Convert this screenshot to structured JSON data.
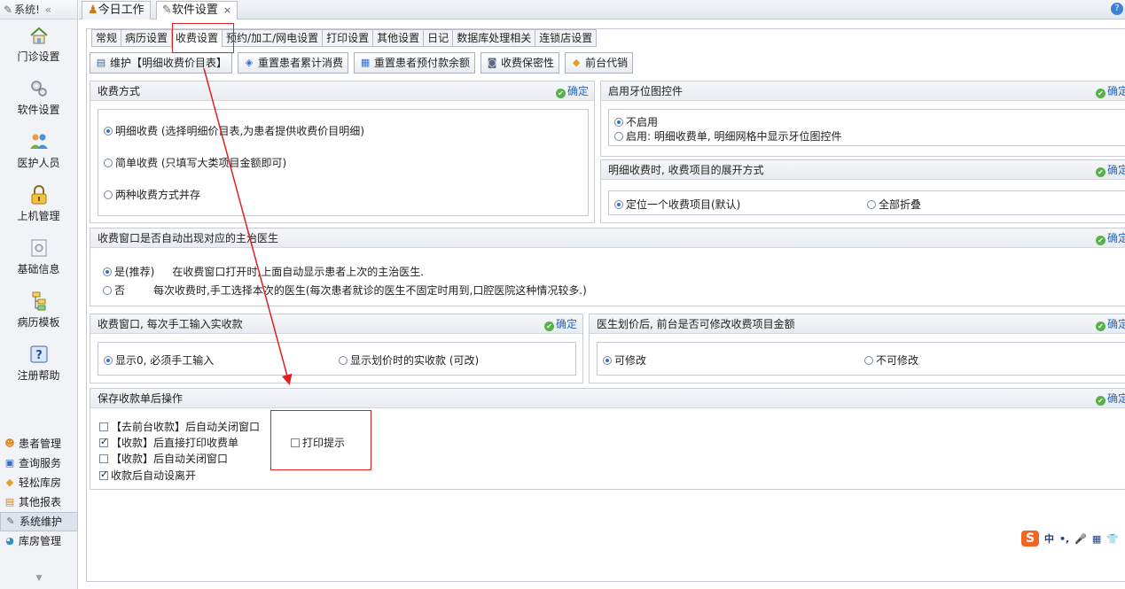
{
  "sidebar": {
    "header": "系统!",
    "big_items": [
      {
        "label": "门诊设置",
        "icon": "home-icon"
      },
      {
        "label": "软件设置",
        "icon": "gears-icon"
      },
      {
        "label": "医护人员",
        "icon": "users-icon"
      },
      {
        "label": "上机管理",
        "icon": "lock-icon"
      },
      {
        "label": "基础信息",
        "icon": "base-info-icon"
      },
      {
        "label": "病历模板",
        "icon": "tree-icon"
      },
      {
        "label": "注册帮助",
        "icon": "help-icon"
      }
    ],
    "list_items": [
      {
        "label": "患者管理",
        "icon": "patients-icon"
      },
      {
        "label": "查询服务",
        "icon": "query-icon"
      },
      {
        "label": "轻松库房",
        "icon": "warehouse-icon"
      },
      {
        "label": "其他报表",
        "icon": "report-icon"
      },
      {
        "label": "系统维护",
        "icon": "wrench-icon"
      },
      {
        "label": "库房管理",
        "icon": "storage-icon"
      }
    ]
  },
  "doc_tabs": [
    {
      "label": "今日工作",
      "icon": "person-icon"
    },
    {
      "label": "软件设置",
      "icon": "gears-icon",
      "close": "×"
    }
  ],
  "sub_tabs": [
    "常规",
    "病历设置",
    "收费设置",
    "预约/加工/网电设置",
    "打印设置",
    "其他设置",
    "日记",
    "数据库处理相关",
    "连锁店设置"
  ],
  "toolbar": [
    "维护【明细收费价目表】",
    "重置患者累计消费",
    "重置患者预付款余额",
    "收费保密性",
    "前台代销"
  ],
  "confirm_label": "确定",
  "charge_method": {
    "title": "收费方式",
    "options": [
      {
        "label": "明细收费 (选择明细价目表,为患者提供收费价目明细)",
        "selected": true
      },
      {
        "label": "简单收费 (只填写大类项目金额即可)",
        "selected": false
      },
      {
        "label": "两种收费方式并存",
        "selected": false
      }
    ]
  },
  "tooth_chart": {
    "title": "启用牙位图控件",
    "options": [
      {
        "label": "不启用",
        "selected": true
      },
      {
        "label": "启用: 明细收费单, 明细网格中显示牙位图控件",
        "selected": false
      }
    ]
  },
  "expand_mode": {
    "title": "明细收费时, 收费项目的展开方式",
    "options": [
      {
        "label": "定位一个收费项目(默认)",
        "selected": true
      },
      {
        "label": "全部折叠",
        "selected": false
      }
    ]
  },
  "auto_doctor": {
    "title": "收费窗口是否自动出现对应的主治医生",
    "options": [
      {
        "label": "是(推荐)",
        "desc": "在收费窗口打开时,上面自动显示患者上次的主治医生.",
        "selected": true
      },
      {
        "label": "否",
        "desc": "每次收费时,手工选择本次的医生(每次患者就诊的医生不固定时用到,口腔医院这种情况较多.)",
        "selected": false
      }
    ]
  },
  "manual_input": {
    "title": "收费窗口, 每次手工输入实收款",
    "options": [
      {
        "label": "显示0, 必须手工输入",
        "selected": true
      },
      {
        "label": "显示划价时的实收款 (可改)",
        "selected": false
      }
    ]
  },
  "modify_amount": {
    "title": "医生划价后, 前台是否可修改收费项目金额",
    "options": [
      {
        "label": "可修改",
        "selected": true
      },
      {
        "label": "不可修改",
        "selected": false
      }
    ]
  },
  "after_save": {
    "title": "保存收款单后操作",
    "checks": [
      {
        "label": "【去前台收款】后自动关闭窗口",
        "checked": false
      },
      {
        "label": "【收款】后直接打印收费单",
        "checked": true
      },
      {
        "label": "【收款】后自动关闭窗口",
        "checked": false
      },
      {
        "label": "收款后自动设离开",
        "checked": true
      }
    ],
    "print_prompt": {
      "label": "打印提示",
      "checked": false
    }
  },
  "ime": {
    "logo": "S",
    "items": [
      "中",
      "•,",
      "🎤",
      "▦",
      "👕"
    ]
  },
  "colors": {
    "accent_blue": "#2e6fd0",
    "confirm_green": "#59b04a",
    "annotation_red": "#e02020"
  }
}
